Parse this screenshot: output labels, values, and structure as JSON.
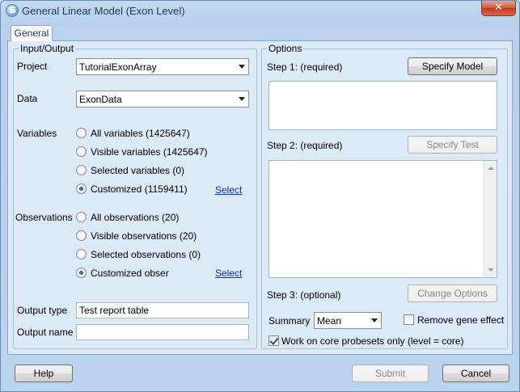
{
  "window": {
    "title": "General Linear Model (Exon Level)",
    "close_glyph": "✕"
  },
  "tabs": [
    {
      "label": "General"
    }
  ],
  "io": {
    "legend": "Input/Output",
    "project": {
      "label": "Project",
      "value": "TutorialExonArray"
    },
    "data": {
      "label": "Data",
      "value": "ExonData"
    },
    "variables": {
      "label": "Variables",
      "options": [
        {
          "label": "All variables (1425647)",
          "selected": false
        },
        {
          "label": "Visible variables (1425647)",
          "selected": false
        },
        {
          "label": "Selected variables (0)",
          "selected": false
        },
        {
          "label": "Customized (1159411)",
          "selected": true
        }
      ],
      "select_link": "Select"
    },
    "observations": {
      "label": "Observations",
      "options": [
        {
          "label": "All observations (20)",
          "selected": false
        },
        {
          "label": "Visible observations (20)",
          "selected": false
        },
        {
          "label": "Selected observations (0)",
          "selected": false
        },
        {
          "label": "Customized obser",
          "selected": true
        }
      ],
      "select_link": "Select"
    },
    "output_type": {
      "label": "Output type",
      "value": "Test report table"
    },
    "output_name": {
      "label": "Output name",
      "value": ""
    }
  },
  "options": {
    "legend": "Options",
    "step1": {
      "label": "Step 1: (required)",
      "button": "Specify Model"
    },
    "step2": {
      "label": "Step 2: (required)",
      "button": "Specify Test"
    },
    "step3": {
      "label": "Step 3: (optional)",
      "button": "Change Options"
    },
    "summary": {
      "label": "Summary",
      "value": "Mean"
    },
    "remove_gene_effect": {
      "label": "Remove gene effect",
      "checked": false
    },
    "core_only": {
      "label": "Work on core probesets only (level = core)",
      "checked": true
    }
  },
  "footer": {
    "help": "Help",
    "submit": "Submit",
    "cancel": "Cancel"
  }
}
